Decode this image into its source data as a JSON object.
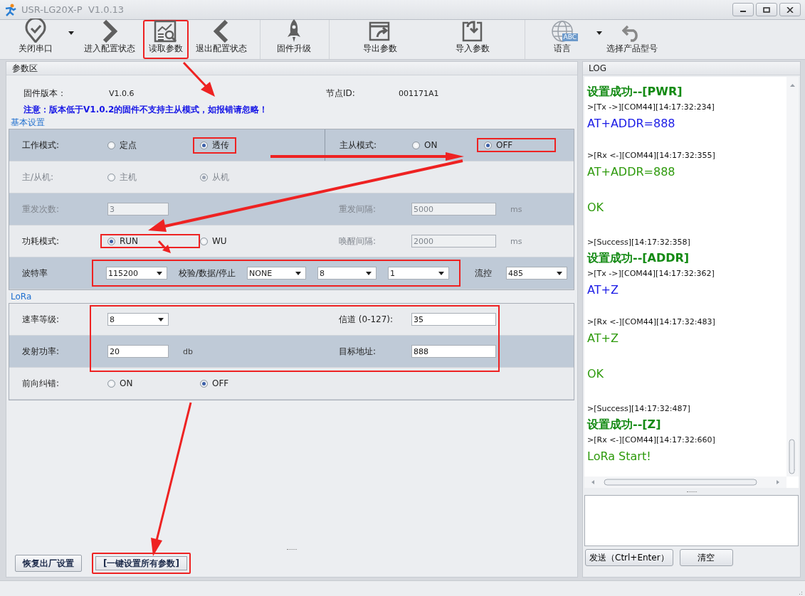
{
  "window": {
    "title": "USR-LG20X-P  V1.0.13"
  },
  "toolbar": [
    [
      {
        "label": "关闭串口",
        "dropdown": true,
        "highlighted": false
      },
      {
        "label": "进入配置状态",
        "dropdown": false,
        "highlighted": false
      },
      {
        "label": "读取参数",
        "dropdown": false,
        "highlighted": true
      },
      {
        "label": "退出配置状态",
        "dropdown": false,
        "highlighted": false
      }
    ],
    [
      {
        "label": "固件升级",
        "dropdown": false,
        "highlighted": false
      }
    ],
    [
      {
        "label": "导出参数",
        "dropdown": false,
        "highlighted": false
      },
      {
        "label": "导入参数",
        "dropdown": false,
        "highlighted": false
      }
    ],
    [
      {
        "label": "语言",
        "badge": "ABC",
        "dropdown": true,
        "highlighted": false
      },
      {
        "label": "选择产品型号",
        "dropdown": false,
        "highlighted": false
      }
    ]
  ],
  "params_panel": {
    "title": "参数区",
    "info": [
      {
        "label": "固件版本：",
        "value": "V1.0.6"
      },
      {
        "label": "节点ID:",
        "value": "001171A1"
      }
    ],
    "notice": "注意：版本低于V1.0.2的固件不支持主从模式，如报错请忽略！",
    "groups": [
      {
        "title": "基本设置",
        "rows": [
          {
            "shaded": true,
            "disabled": false,
            "highlighted": false,
            "divider": true,
            "left": [
              {
                "kind": "label",
                "text": "工作模式:"
              },
              {
                "kind": "radio",
                "text": "定点",
                "selected": false,
                "highlighted": false
              },
              {
                "kind": "radio",
                "text": "透传",
                "selected": true,
                "highlighted": true
              }
            ],
            "right": [
              {
                "kind": "label",
                "text": "主从模式:"
              },
              {
                "kind": "radio",
                "text": "ON",
                "selected": false,
                "highlighted": false
              },
              {
                "kind": "radio",
                "text": "OFF",
                "selected": true,
                "highlighted": true
              }
            ]
          },
          {
            "shaded": false,
            "disabled": true,
            "highlighted": false,
            "divider": false,
            "left": [
              {
                "kind": "label",
                "text": "主/从机:"
              },
              {
                "kind": "radio",
                "text": "主机",
                "selected": false,
                "highlighted": false
              },
              {
                "kind": "radio",
                "text": "从机",
                "selected": true,
                "highlighted": false
              }
            ],
            "right": []
          },
          {
            "shaded": true,
            "disabled": true,
            "highlighted": false,
            "divider": false,
            "left": [
              {
                "kind": "label",
                "text": "重发次数:"
              },
              {
                "kind": "field",
                "value": "3",
                "disabled": true
              }
            ],
            "right": [
              {
                "kind": "label",
                "text": "重发间隔:"
              },
              {
                "kind": "field",
                "value": "5000",
                "disabled": true
              },
              {
                "kind": "unit",
                "text": "ms"
              }
            ]
          },
          {
            "shaded": false,
            "disabled": false,
            "highlighted": false,
            "divider": false,
            "left": [
              {
                "kind": "label",
                "text": "功耗模式:"
              },
              {
                "kind": "radio",
                "text": "RUN",
                "selected": true,
                "highlighted": true
              },
              {
                "kind": "radio",
                "text": "WU",
                "selected": false,
                "highlighted": false
              }
            ],
            "right": [
              {
                "kind": "label",
                "text": "唤醒间隔:",
                "disabled": true
              },
              {
                "kind": "field",
                "value": "2000",
                "disabled": true
              },
              {
                "kind": "unit",
                "text": "ms",
                "disabled": true
              }
            ]
          },
          {
            "shaded": true,
            "disabled": false,
            "highlighted": false,
            "divider": false,
            "kind": "serial",
            "items": [
              {
                "kind": "label",
                "text": "波特率"
              },
              {
                "kind": "group",
                "highlighted": true,
                "items": [
                  {
                    "kind": "select",
                    "value": "115200"
                  },
                  {
                    "kind": "label",
                    "text": "校验/数据/停止"
                  },
                  {
                    "kind": "select",
                    "value": "NONE"
                  },
                  {
                    "kind": "select",
                    "value": "8"
                  },
                  {
                    "kind": "select",
                    "value": "1"
                  }
                ]
              },
              {
                "kind": "label",
                "text": "流控"
              },
              {
                "kind": "select",
                "value": "485"
              }
            ]
          }
        ]
      },
      {
        "title": "LoRa",
        "rows": [
          {
            "shaded": false,
            "disabled": false,
            "highlighted": true,
            "divider": false,
            "left": [
              {
                "kind": "label",
                "text": "速率等级:"
              },
              {
                "kind": "select",
                "value": "8"
              }
            ],
            "right": [
              {
                "kind": "label",
                "text": "信道 (0-127):"
              },
              {
                "kind": "field",
                "value": "35",
                "disabled": false
              }
            ]
          },
          {
            "shaded": true,
            "disabled": false,
            "highlighted": true,
            "divider": false,
            "left": [
              {
                "kind": "label",
                "text": "发射功率:"
              },
              {
                "kind": "field",
                "value": "20",
                "disabled": false
              },
              {
                "kind": "unit",
                "text": "db"
              }
            ],
            "right": [
              {
                "kind": "label",
                "text": "目标地址:"
              },
              {
                "kind": "field",
                "value": "888",
                "disabled": false
              }
            ]
          },
          {
            "shaded": false,
            "disabled": false,
            "highlighted": false,
            "divider": false,
            "left": [
              {
                "kind": "label",
                "text": "前向纠错:"
              },
              {
                "kind": "radio",
                "text": "ON",
                "selected": false,
                "highlighted": false
              },
              {
                "kind": "radio",
                "text": "OFF",
                "selected": true,
                "highlighted": false
              }
            ],
            "right": []
          }
        ]
      }
    ],
    "buttons": [
      {
        "label": "恢复出厂设置",
        "highlighted": false
      },
      {
        "label": "[一键设置所有参数]",
        "highlighted": true
      }
    ]
  },
  "log_panel": {
    "title": "LOG",
    "entries": [
      {
        "kind": "heading",
        "text": "设置成功--[PWR]"
      },
      {
        "kind": "meta",
        "text": ">[Tx ->][COM44][14:17:32:234]"
      },
      {
        "kind": "tx",
        "text": "AT+ADDR=888"
      },
      {
        "kind": "meta",
        "text": ">[Rx <-][COM44][14:17:32:355]"
      },
      {
        "kind": "rx",
        "text": "AT+ADDR=888"
      },
      {
        "kind": "rx",
        "text": "OK"
      },
      {
        "kind": "meta",
        "text": ">[Success][14:17:32:358]"
      },
      {
        "kind": "heading",
        "text": "设置成功--[ADDR]"
      },
      {
        "kind": "meta",
        "text": ">[Tx ->][COM44][14:17:32:362]"
      },
      {
        "kind": "tx",
        "text": "AT+Z"
      },
      {
        "kind": "meta",
        "text": ">[Rx <-][COM44][14:17:32:483]"
      },
      {
        "kind": "rx",
        "text": "AT+Z"
      },
      {
        "kind": "rx",
        "text": "OK"
      },
      {
        "kind": "meta",
        "text": ">[Success][14:17:32:487]"
      },
      {
        "kind": "heading",
        "text": "设置成功--[Z]"
      },
      {
        "kind": "meta",
        "text": ">[Rx <-][COM44][14:17:32:660]"
      },
      {
        "kind": "rx_last",
        "text": "LoRa Start!"
      }
    ],
    "buttons": [
      "发送（Ctrl+Enter）",
      "清空"
    ]
  }
}
